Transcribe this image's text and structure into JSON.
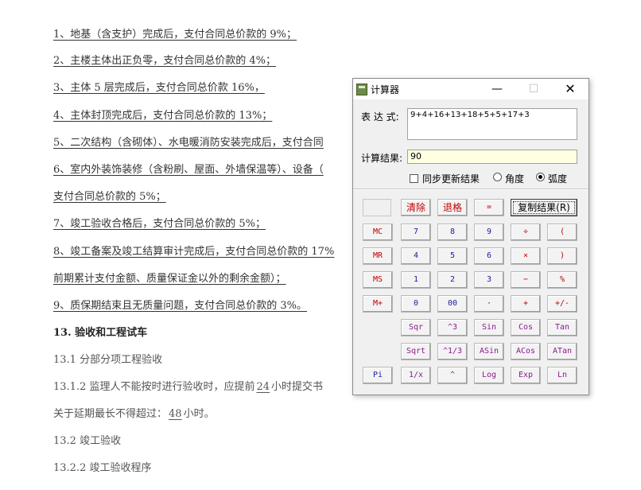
{
  "document": {
    "lines": [
      "1、地基（含支护）完成后，支付合同总价款的 9%；",
      "2、主楼主体出正负零，支付合同总价款的 4%；",
      "3、主体 5 层完成后，支付合同总价款 16%，",
      "4、主体封顶完成后，支付合同总价款的 13%；",
      "5、二次结构（含砌体）、水电暖消防安装完成后，支付合同",
      "6、室内外装饰装修（含粉刷、屋面、外墙保温等）、设备（",
      "支付合同总价款的 5%；",
      "7、竣工验收合格后，支付合同总价款的 5%；",
      "8、竣工备案及竣工结算审计完成后，支付合同总价款的 17%",
      "前期累计支付金额、质量保证金以外的剩余金额）；",
      "9、质保期结束且无质量问题，支付合同总价款的 3%。",
      "13. 验收和工程试车",
      "13.1 分部分项工程验收",
      "13.1.2 监理人不能按时进行验收时，应提前",
      "24",
      "小时提交书",
      "关于延期最长不得超过：",
      "48",
      "小时。",
      "13.2 竣工验收",
      "13.2.2 竣工验收程序"
    ]
  },
  "calculator": {
    "title": "计算器",
    "window_buttons": {
      "minimize": "—",
      "maximize": "☐",
      "close": "✕"
    },
    "expression_label": "表 达 式:",
    "expression_value": "9+4+16+13+18+5+5+17+3",
    "result_label": "计算结果:",
    "result_value": "90",
    "sync_label": "同步更新结果",
    "sync_checked": false,
    "angle_mode": {
      "degree_label": "角度",
      "radian_label": "弧度",
      "selected": "radian"
    },
    "buttons": {
      "clear": "清除",
      "backspace": "退格",
      "equals": "=",
      "copy": "复制结果(R)",
      "mc": "MC",
      "mr": "MR",
      "ms": "MS",
      "mplus": "M+",
      "pi": "Pi",
      "d7": "7",
      "d8": "8",
      "d9": "9",
      "div": "÷",
      "lparen": "(",
      "d4": "4",
      "d5": "5",
      "d6": "6",
      "mul": "×",
      "rparen": ")",
      "d1": "1",
      "d2": "2",
      "d3": "3",
      "sub": "−",
      "pct": "%",
      "d0": "0",
      "d00": "00",
      "dot": "·",
      "add": "+",
      "neg": "+/-",
      "sqr": "Sqr",
      "cube": "^3",
      "sin": "Sin",
      "cos": "Cos",
      "tan": "Tan",
      "sqrt": "Sqrt",
      "cbrt": "^1/3",
      "asin": "ASin",
      "acos": "ACos",
      "atan": "ATan",
      "recip": "1/x",
      "pow": "^",
      "log": "Log",
      "exp": "Exp",
      "ln": "Ln"
    }
  }
}
